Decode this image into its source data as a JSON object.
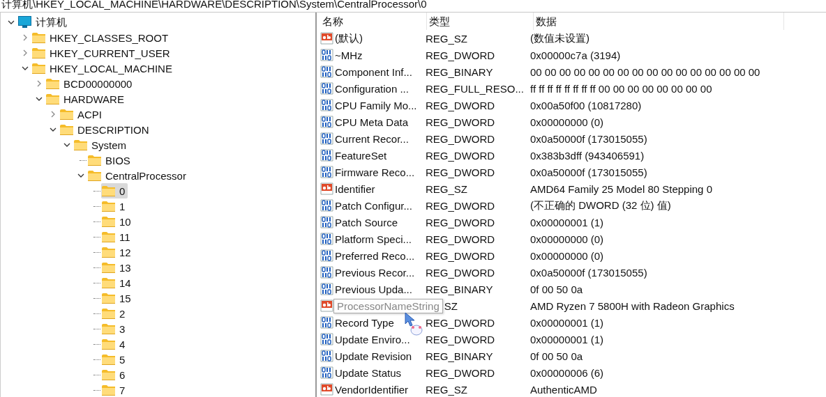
{
  "address_bar": {
    "path": "计算机\\HKEY_LOCAL_MACHINE\\HARDWARE\\DESCRIPTION\\System\\CentralProcessor\\0"
  },
  "tree": [
    {
      "kind": "computer",
      "label": "计算机",
      "expanded": true,
      "selected": false,
      "children": [
        {
          "label": "HKEY_CLASSES_ROOT",
          "expanded": false,
          "selected": false
        },
        {
          "label": "HKEY_CURRENT_USER",
          "expanded": false,
          "selected": false
        },
        {
          "label": "HKEY_LOCAL_MACHINE",
          "expanded": true,
          "selected": false,
          "children": [
            {
              "label": "BCD00000000",
              "expanded": false,
              "selected": false
            },
            {
              "label": "HARDWARE",
              "expanded": true,
              "selected": false,
              "children": [
                {
                  "label": "ACPI",
                  "expanded": false,
                  "selected": false
                },
                {
                  "label": "DESCRIPTION",
                  "expanded": true,
                  "selected": false,
                  "children": [
                    {
                      "label": "System",
                      "expanded": true,
                      "selected": false,
                      "children": [
                        {
                          "label": "BIOS",
                          "selected": false
                        },
                        {
                          "label": "CentralProcessor",
                          "expanded": true,
                          "selected": false,
                          "children": [
                            {
                              "label": "0",
                              "selected": true
                            },
                            {
                              "label": "1",
                              "selected": false
                            },
                            {
                              "label": "10",
                              "selected": false
                            },
                            {
                              "label": "11",
                              "selected": false
                            },
                            {
                              "label": "12",
                              "selected": false
                            },
                            {
                              "label": "13",
                              "selected": false
                            },
                            {
                              "label": "14",
                              "selected": false
                            },
                            {
                              "label": "15",
                              "selected": false
                            },
                            {
                              "label": "2",
                              "selected": false
                            },
                            {
                              "label": "3",
                              "selected": false
                            },
                            {
                              "label": "4",
                              "selected": false
                            },
                            {
                              "label": "5",
                              "selected": false
                            },
                            {
                              "label": "6",
                              "selected": false
                            },
                            {
                              "label": "7",
                              "selected": false
                            }
                          ]
                        }
                      ]
                    }
                  ]
                }
              ]
            }
          ]
        }
      ]
    }
  ],
  "values": {
    "columns": [
      "名称",
      "类型",
      "数据"
    ],
    "rows": [
      {
        "kind": "string",
        "name": "(默认)",
        "type": "REG_SZ",
        "data": "(数值未设置)"
      },
      {
        "kind": "binary",
        "name": "~MHz",
        "type": "REG_DWORD",
        "data": "0x00000c7a (3194)"
      },
      {
        "kind": "binary",
        "name": "Component Inf...",
        "type": "REG_BINARY",
        "data": "00 00 00 00 00 00 00 00 00 00 00 00 00 00 00 00"
      },
      {
        "kind": "binary",
        "name": "Configuration ...",
        "type": "REG_FULL_RESO...",
        "data": "ff ff ff ff ff ff ff ff 00 00 00 00 00 00 00 00"
      },
      {
        "kind": "binary",
        "name": "CPU Family Mo...",
        "type": "REG_DWORD",
        "data": "0x00a50f00 (10817280)"
      },
      {
        "kind": "binary",
        "name": "CPU Meta Data",
        "type": "REG_DWORD",
        "data": "0x00000000 (0)"
      },
      {
        "kind": "binary",
        "name": "Current Recor...",
        "type": "REG_DWORD",
        "data": "0x0a50000f (173015055)"
      },
      {
        "kind": "binary",
        "name": "FeatureSet",
        "type": "REG_DWORD",
        "data": "0x383b3dff (943406591)"
      },
      {
        "kind": "binary",
        "name": "Firmware Reco...",
        "type": "REG_DWORD",
        "data": "0x0a50000f (173015055)"
      },
      {
        "kind": "string",
        "name": "Identifier",
        "type": "REG_SZ",
        "data": "AMD64 Family 25 Model 80 Stepping 0"
      },
      {
        "kind": "binary",
        "name": "Patch Configur...",
        "type": "REG_DWORD",
        "data": "(不正确的 DWORD  (32 位) 值)"
      },
      {
        "kind": "binary",
        "name": "Patch Source",
        "type": "REG_DWORD",
        "data": "0x00000001 (1)"
      },
      {
        "kind": "binary",
        "name": "Platform Speci...",
        "type": "REG_DWORD",
        "data": "0x00000000 (0)"
      },
      {
        "kind": "binary",
        "name": "Preferred Reco...",
        "type": "REG_DWORD",
        "data": "0x00000000 (0)"
      },
      {
        "kind": "binary",
        "name": "Previous Recor...",
        "type": "REG_DWORD",
        "data": "0x0a50000f (173015055)"
      },
      {
        "kind": "binary",
        "name": "Previous Upda...",
        "type": "REG_BINARY",
        "data": "0f 00 50 0a"
      },
      {
        "kind": "string",
        "name": "ProcessorNameString",
        "type": "SZ",
        "data": "AMD Ryzen 7 5800H with Radeon Graphics",
        "tooltip": true
      },
      {
        "kind": "binary",
        "name": "Record Type",
        "type": "REG_DWORD",
        "data": "0x00000001 (1)"
      },
      {
        "kind": "binary",
        "name": "Update Enviro...",
        "type": "REG_DWORD",
        "data": "0x00000001 (1)"
      },
      {
        "kind": "binary",
        "name": "Update Revision",
        "type": "REG_BINARY",
        "data": "0f 00 50 0a"
      },
      {
        "kind": "binary",
        "name": "Update Status",
        "type": "REG_DWORD",
        "data": "0x00000006 (6)"
      },
      {
        "kind": "string",
        "name": "VendorIdentifier",
        "type": "REG_SZ",
        "data": "AuthenticAMD"
      }
    ]
  }
}
